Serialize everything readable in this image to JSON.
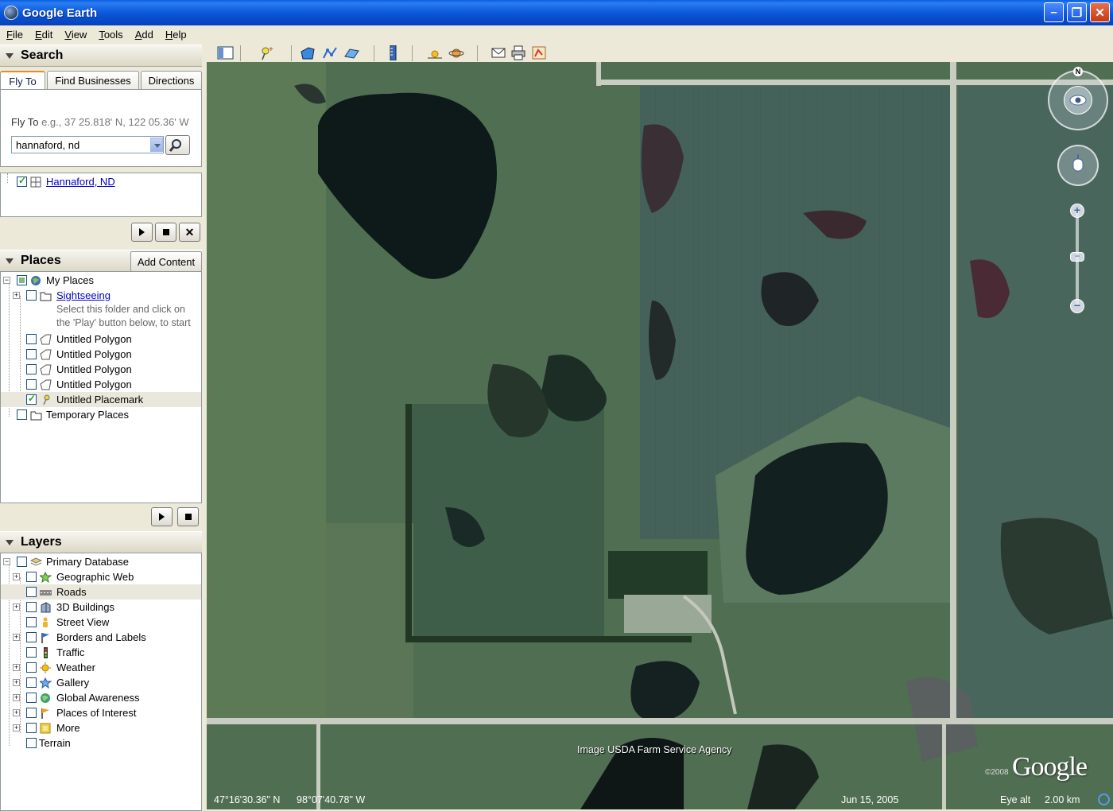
{
  "window": {
    "title": "Google Earth"
  },
  "menu": [
    "File",
    "Edit",
    "View",
    "Tools",
    "Add",
    "Help"
  ],
  "search": {
    "header": "Search",
    "tabs": [
      "Fly To",
      "Find Businesses",
      "Directions"
    ],
    "flyto_label": "Fly To",
    "flyto_example": "e.g., 37 25.818' N, 122 05.36' W",
    "query": "hannaford, nd",
    "result": "Hannaford, ND"
  },
  "places": {
    "header": "Places",
    "add_content": "Add Content",
    "my_places": "My Places",
    "sightseeing": "Sightseeing",
    "sightseeing_note": [
      "Select this folder and click on",
      "the 'Play' button below, to start"
    ],
    "polygons": [
      "Untitled Polygon",
      "Untitled Polygon",
      "Untitled Polygon",
      "Untitled Polygon"
    ],
    "placemark": "Untitled Placemark",
    "temporary": "Temporary Places"
  },
  "layers": {
    "header": "Layers",
    "primary": "Primary Database",
    "items": [
      "Geographic Web",
      "Roads",
      "3D Buildings",
      "Street View",
      "Borders and Labels",
      "Traffic",
      "Weather",
      "Gallery",
      "Global Awareness",
      "Places of Interest",
      "More"
    ],
    "terrain": "Terrain"
  },
  "map": {
    "attribution": "Image USDA Farm Service Agency",
    "logo": "Google",
    "copyright": "©2008",
    "compass_n": "N",
    "lat": "47°16'30.36\" N",
    "lon": "98°07'40.78\" W",
    "date": "Jun 15, 2005",
    "eye_alt_label": "Eye alt",
    "eye_alt_value": "2.00 km"
  },
  "colors": {
    "titlebar": "#0a58d8",
    "link": "#0000cc",
    "panel": "#ece9d8"
  }
}
